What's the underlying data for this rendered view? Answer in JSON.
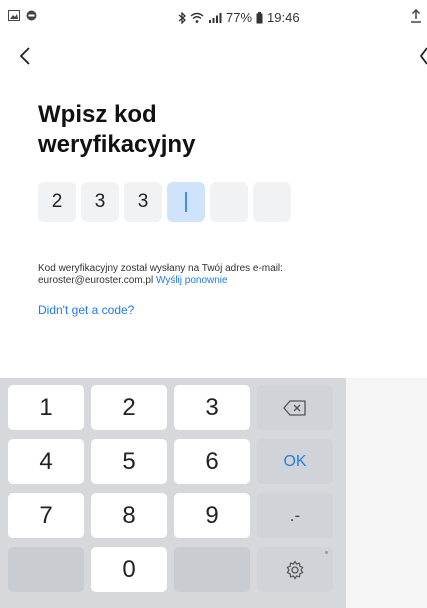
{
  "status_bar": {
    "battery_percent": "77%",
    "time": "19:46"
  },
  "page": {
    "title": "Wpisz kod weryfikacyjny"
  },
  "code": {
    "digits": [
      "2",
      "3",
      "3",
      "",
      "",
      ""
    ],
    "active_index": 3
  },
  "info": {
    "message": "Kod weryfikacyjny został wysłany na Twój adres e-mail: euroster@euroster.com.pl",
    "resend_label": "Wyślij ponownie"
  },
  "help": {
    "no_code_label": "Didn't get a code?"
  },
  "keyboard": {
    "k1": "1",
    "k2": "2",
    "k3": "3",
    "k4": "4",
    "k5": "5",
    "k6": "6",
    "k7": "7",
    "k8": "8",
    "k9": "9",
    "k0": "0",
    "ok": "OK",
    "symbols": ".-"
  },
  "colors": {
    "accent": "#1d7af2",
    "active_box": "#cfe3fb",
    "keyboard_bg": "#d6d8dc"
  }
}
